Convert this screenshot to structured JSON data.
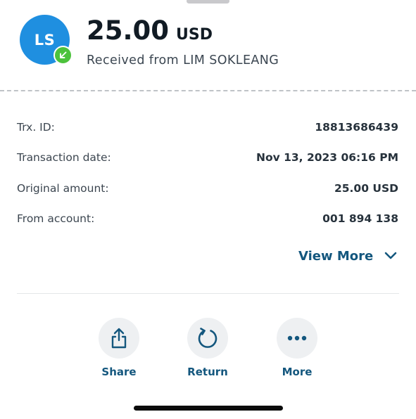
{
  "header": {
    "avatar_initials": "LS",
    "amount": "25.00",
    "currency": "USD",
    "subtitle": "Received from LIM SOKLEANG"
  },
  "details": [
    {
      "label": "Trx. ID:",
      "value": "18813686439"
    },
    {
      "label": "Transaction date:",
      "value": "Nov 13, 2023 06:16 PM"
    },
    {
      "label": "Original amount:",
      "value": "25.00 USD"
    },
    {
      "label": "From account:",
      "value": "001 894 138"
    }
  ],
  "view_more_label": "View More",
  "actions": [
    {
      "label": "Share",
      "icon": "share-icon"
    },
    {
      "label": "Return",
      "icon": "return-icon"
    },
    {
      "label": "More",
      "icon": "more-icon"
    }
  ],
  "colors": {
    "avatar": "#1f8fe0",
    "badge": "#4cc23c",
    "accent": "#14577e"
  }
}
